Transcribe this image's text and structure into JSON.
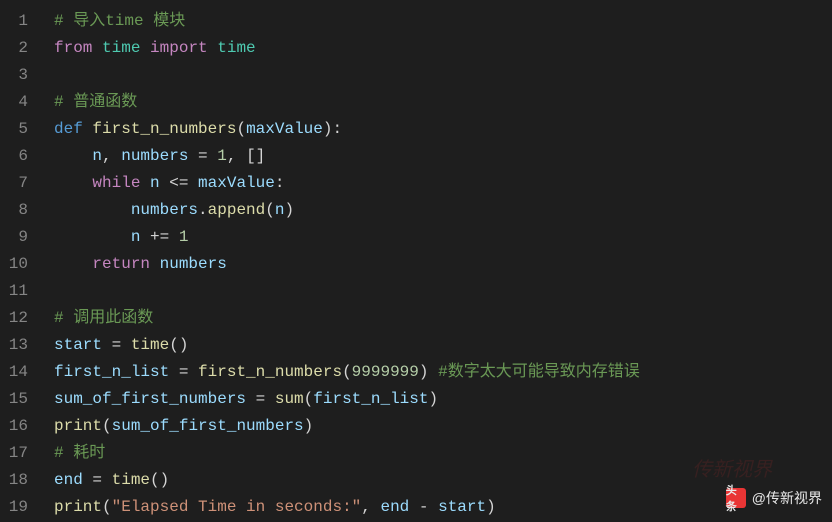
{
  "lines": [
    {
      "num": "1",
      "tokens": [
        [
          "tok-comment",
          "# 导入time 模块"
        ]
      ]
    },
    {
      "num": "2",
      "tokens": [
        [
          "tok-keyword2",
          "from"
        ],
        [
          "",
          " "
        ],
        [
          "tok-module",
          "time"
        ],
        [
          "",
          " "
        ],
        [
          "tok-keyword2",
          "import"
        ],
        [
          "",
          " "
        ],
        [
          "tok-module",
          "time"
        ]
      ]
    },
    {
      "num": "3",
      "tokens": []
    },
    {
      "num": "4",
      "tokens": [
        [
          "tok-comment",
          "# 普通函数"
        ]
      ]
    },
    {
      "num": "5",
      "tokens": [
        [
          "tok-keyword",
          "def"
        ],
        [
          "",
          " "
        ],
        [
          "tok-func",
          "first_n_numbers"
        ],
        [
          "tok-paren",
          "("
        ],
        [
          "tok-param",
          "maxValue"
        ],
        [
          "tok-paren",
          ")"
        ],
        [
          "tok-op",
          ":"
        ]
      ]
    },
    {
      "num": "6",
      "tokens": [
        [
          "",
          "    "
        ],
        [
          "tok-var",
          "n"
        ],
        [
          "tok-op",
          ", "
        ],
        [
          "tok-var",
          "numbers"
        ],
        [
          "tok-op",
          " = "
        ],
        [
          "tok-number",
          "1"
        ],
        [
          "tok-op",
          ", []"
        ]
      ]
    },
    {
      "num": "7",
      "tokens": [
        [
          "",
          "    "
        ],
        [
          "tok-keyword2",
          "while"
        ],
        [
          "",
          " "
        ],
        [
          "tok-var",
          "n"
        ],
        [
          "tok-op",
          " <= "
        ],
        [
          "tok-var",
          "maxValue"
        ],
        [
          "tok-op",
          ":"
        ]
      ]
    },
    {
      "num": "8",
      "tokens": [
        [
          "",
          "        "
        ],
        [
          "tok-var",
          "numbers"
        ],
        [
          "tok-op",
          "."
        ],
        [
          "tok-func",
          "append"
        ],
        [
          "tok-paren",
          "("
        ],
        [
          "tok-var",
          "n"
        ],
        [
          "tok-paren",
          ")"
        ]
      ]
    },
    {
      "num": "9",
      "tokens": [
        [
          "",
          "        "
        ],
        [
          "tok-var",
          "n"
        ],
        [
          "tok-op",
          " += "
        ],
        [
          "tok-number",
          "1"
        ]
      ]
    },
    {
      "num": "10",
      "tokens": [
        [
          "",
          "    "
        ],
        [
          "tok-keyword2",
          "return"
        ],
        [
          "",
          " "
        ],
        [
          "tok-var",
          "numbers"
        ]
      ]
    },
    {
      "num": "11",
      "tokens": []
    },
    {
      "num": "12",
      "tokens": [
        [
          "tok-comment",
          "# 调用此函数"
        ]
      ]
    },
    {
      "num": "13",
      "tokens": [
        [
          "tok-var",
          "start"
        ],
        [
          "tok-op",
          " = "
        ],
        [
          "tok-func",
          "time"
        ],
        [
          "tok-paren",
          "()"
        ]
      ]
    },
    {
      "num": "14",
      "tokens": [
        [
          "tok-var",
          "first_n_list"
        ],
        [
          "tok-op",
          " = "
        ],
        [
          "tok-func",
          "first_n_numbers"
        ],
        [
          "tok-paren",
          "("
        ],
        [
          "tok-number",
          "9999999"
        ],
        [
          "tok-paren",
          ")"
        ],
        [
          "",
          " "
        ],
        [
          "tok-comment",
          "#数字太大可能导致内存错误"
        ]
      ]
    },
    {
      "num": "15",
      "tokens": [
        [
          "tok-var",
          "sum_of_first_numbers"
        ],
        [
          "tok-op",
          " = "
        ],
        [
          "tok-builtin",
          "sum"
        ],
        [
          "tok-paren",
          "("
        ],
        [
          "tok-var",
          "first_n_list"
        ],
        [
          "tok-paren",
          ")"
        ]
      ]
    },
    {
      "num": "16",
      "tokens": [
        [
          "tok-builtin",
          "print"
        ],
        [
          "tok-paren",
          "("
        ],
        [
          "tok-var",
          "sum_of_first_numbers"
        ],
        [
          "tok-paren",
          ")"
        ]
      ]
    },
    {
      "num": "17",
      "tokens": [
        [
          "tok-comment",
          "# 耗时"
        ]
      ]
    },
    {
      "num": "18",
      "tokens": [
        [
          "tok-var",
          "end"
        ],
        [
          "tok-op",
          " = "
        ],
        [
          "tok-func",
          "time"
        ],
        [
          "tok-paren",
          "()"
        ]
      ]
    },
    {
      "num": "19",
      "tokens": [
        [
          "tok-builtin",
          "print"
        ],
        [
          "tok-paren",
          "("
        ],
        [
          "tok-string",
          "\"Elapsed Time in seconds:\""
        ],
        [
          "tok-op",
          ", "
        ],
        [
          "tok-var",
          "end"
        ],
        [
          "tok-op",
          " - "
        ],
        [
          "tok-var",
          "start"
        ],
        [
          "tok-paren",
          ")"
        ]
      ]
    }
  ],
  "watermark": {
    "brand_left": "头条",
    "brand_right": "@传新视界",
    "bg_text": "传新视界"
  }
}
